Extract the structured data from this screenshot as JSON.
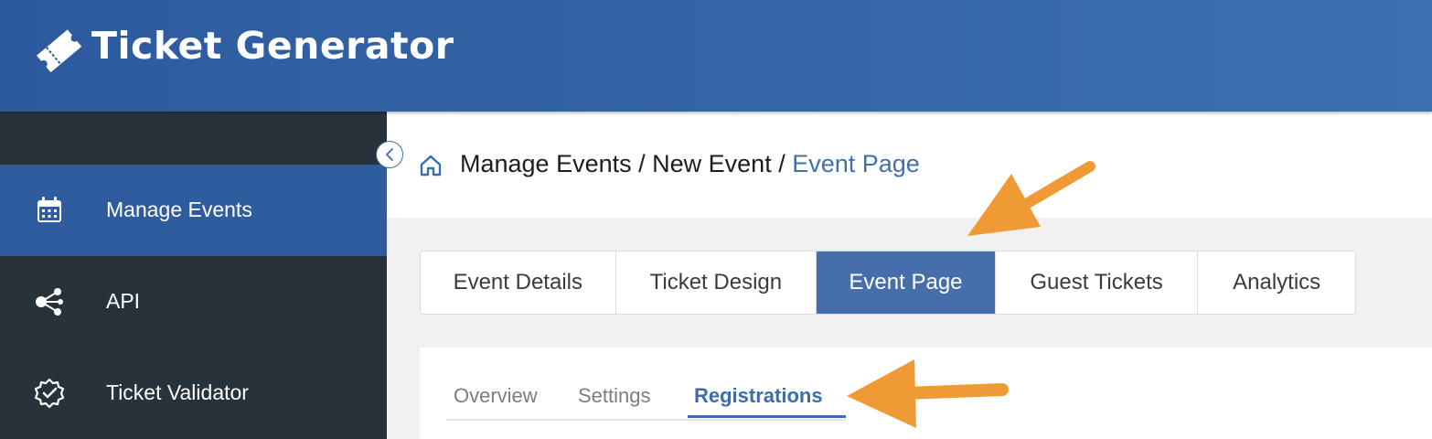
{
  "app": {
    "title": "Ticket Generator",
    "logo_icon": "ticket-icon"
  },
  "sidebar": {
    "items": [
      {
        "label": "Manage Events",
        "icon": "calendar-icon",
        "active": true
      },
      {
        "label": "API",
        "icon": "share-nodes-icon",
        "active": false
      },
      {
        "label": "Ticket Validator",
        "icon": "badge-check-icon",
        "active": false
      }
    ],
    "collapse_icon": "chevron-left-icon"
  },
  "breadcrumb": {
    "icon": "home-icon",
    "items": [
      "Manage Events",
      "New Event",
      "Event Page"
    ],
    "separator": " / "
  },
  "tabs": [
    {
      "label": "Event Details",
      "active": false
    },
    {
      "label": "Ticket Design",
      "active": false
    },
    {
      "label": "Event Page",
      "active": true
    },
    {
      "label": "Guest Tickets",
      "active": false
    },
    {
      "label": "Analytics",
      "active": false
    }
  ],
  "subtabs": [
    {
      "label": "Overview",
      "active": false
    },
    {
      "label": "Settings",
      "active": false
    },
    {
      "label": "Registrations",
      "active": true
    }
  ],
  "colors": {
    "header": "#2d5a9e",
    "sidebar": "#27323b",
    "active_blue": "#456eab",
    "annotation_arrow": "#f09a36"
  }
}
